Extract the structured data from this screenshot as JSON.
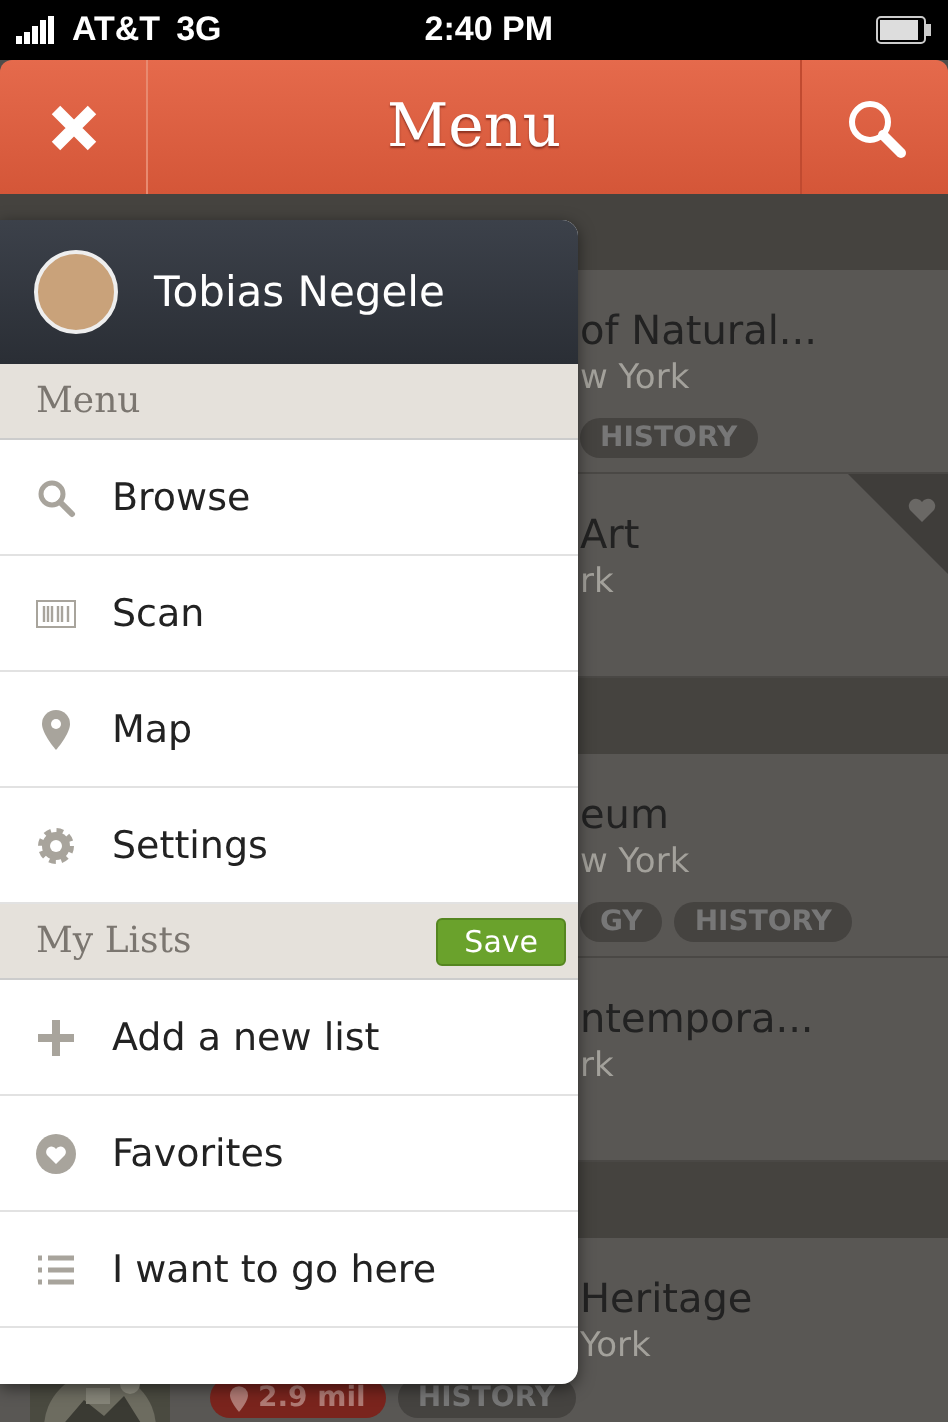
{
  "status_bar": {
    "carrier": "AT&T",
    "network": "3G",
    "time": "2:40 PM"
  },
  "header": {
    "title": "Menu"
  },
  "background": {
    "groups": [
      {
        "cards": [
          {
            "title": "of Natural...",
            "subtitle": "w York",
            "favorite": false,
            "tags": [
              {
                "label": "HISTORY",
                "kind": "category"
              }
            ]
          },
          {
            "title": "Art",
            "subtitle": "rk",
            "favorite": true
          }
        ]
      },
      {
        "cards": [
          {
            "title": "eum",
            "subtitle": "w York",
            "favorite": false,
            "tags": [
              {
                "label": "GY",
                "kind": "category"
              },
              {
                "label": "HISTORY",
                "kind": "category"
              }
            ]
          },
          {
            "title": "ntempora...",
            "subtitle": "rk",
            "favorite": false
          }
        ]
      },
      {
        "cards": [
          {
            "title": "Heritage",
            "subtitle": "York",
            "favorite": false,
            "picture": true,
            "tags": [
              {
                "label": "2.9 mil",
                "kind": "distance"
              },
              {
                "label": "HISTORY",
                "kind": "category"
              }
            ]
          }
        ]
      }
    ]
  },
  "menu": {
    "user": {
      "name": "Tobias Negele"
    },
    "sections": [
      {
        "title": "Menu",
        "items": [
          {
            "label": "Browse"
          },
          {
            "label": "Scan"
          },
          {
            "label": "Map"
          },
          {
            "label": "Settings"
          }
        ]
      },
      {
        "title": "My Lists",
        "action": "Save",
        "items": [
          {
            "label": "Add a new list"
          },
          {
            "label": "Favorites"
          },
          {
            "label": "I want to go here"
          }
        ]
      }
    ]
  }
}
